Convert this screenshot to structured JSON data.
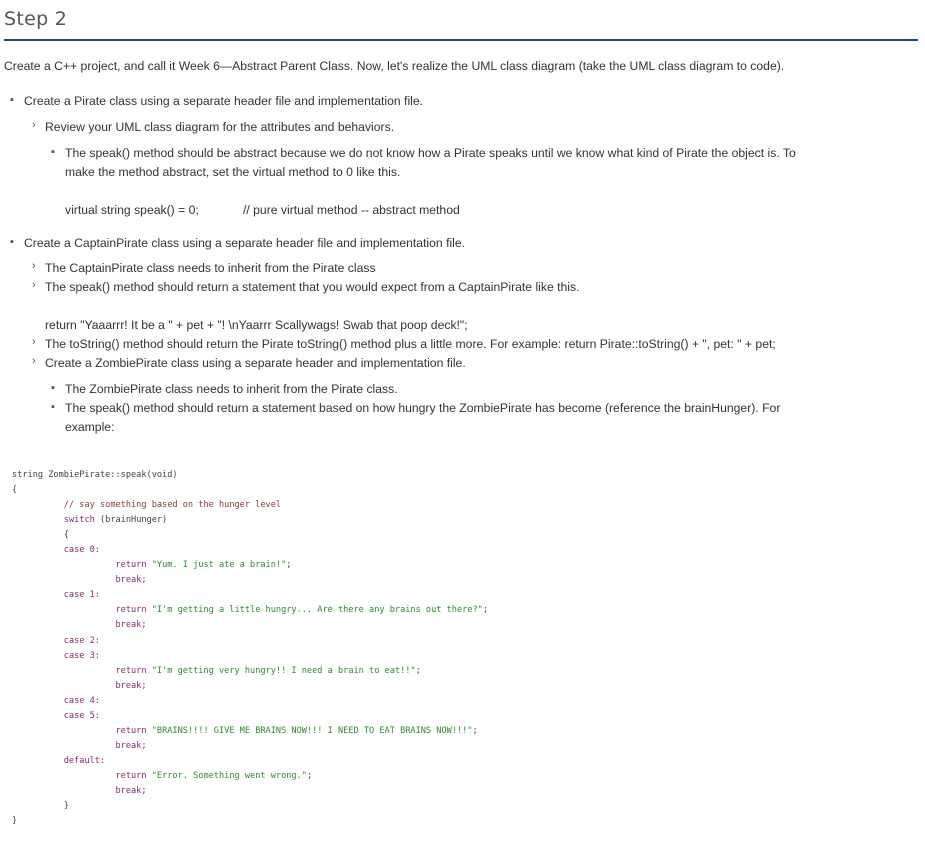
{
  "title": "Step 2",
  "intro": "Create a C++ project, and call it Week 6—Abstract Parent Class. Now, let's realize the UML class diagram (take the UML class diagram to code).",
  "b1": "Create a Pirate class using a separate header file and implementation file.",
  "b1_1": "Review your UML class diagram for the attributes and behaviors.",
  "b1_1_1a": "The speak() method should be abstract because we do not know how a Pirate speaks until we know what kind of Pirate the object is. To",
  "b1_1_1b": "make the method abstract, set the virtual method to 0 like this.",
  "virtual_code": "virtual string speak() = 0;",
  "virtual_comment": "// pure virtual method -- abstract method",
  "b2": "Create a CaptainPirate class using a separate header file and implementation file.",
  "b2_1": "The CaptainPirate class needs to inherit from the Pirate class",
  "b2_2": "The speak() method should return a statement that you would expect from a CaptainPirate like this.",
  "return_line": "return \"Yaaarrr! It be a \" + pet + \"! \\nYaarrr Scallywags! Swab that poop deck!\";",
  "b2_3": "The toString() method should return the Pirate toString() method plus a little more. For example: return Pirate::toString() + \", pet: \" + pet;",
  "b2_4": "Create a ZombiePirate class using a separate header and implementation file.",
  "b2_4_1": "The ZombiePirate class needs to inherit from the Pirate class.",
  "b2_4_2a": "The speak() method should return a statement based on how hungry the ZombiePirate has become (reference the brainHunger). For",
  "b2_4_2b": "example:",
  "code": {
    "sig": "string ZombiePirate::speak(void)",
    "open": "{",
    "comment": "// say something based on the hunger level",
    "switch_kw": "switch",
    "switch_arg": " (brainHunger)",
    "case0": "case 0:",
    "ret_kw": "return",
    "str0": "\"Yum. I just ate a brain!\"",
    "break": "break;",
    "case1": "case 1:",
    "str1": "\"I'm getting a little hungry... Are there any brains out there?\"",
    "case2": "case 2:",
    "case3": "case 3:",
    "str3": "\"I'm getting very hungry!! I need a brain to eat!!\"",
    "case4": "case 4:",
    "case5": "case 5:",
    "str5": "\"BRAINS!!!! GIVE ME BRAINS NOW!!! I NEED TO EAT BRAINS NOW!!!\"",
    "default": "default:",
    "str_def": "\"Error. Something went wrong.\"",
    "semi": ";",
    "close": "}"
  }
}
